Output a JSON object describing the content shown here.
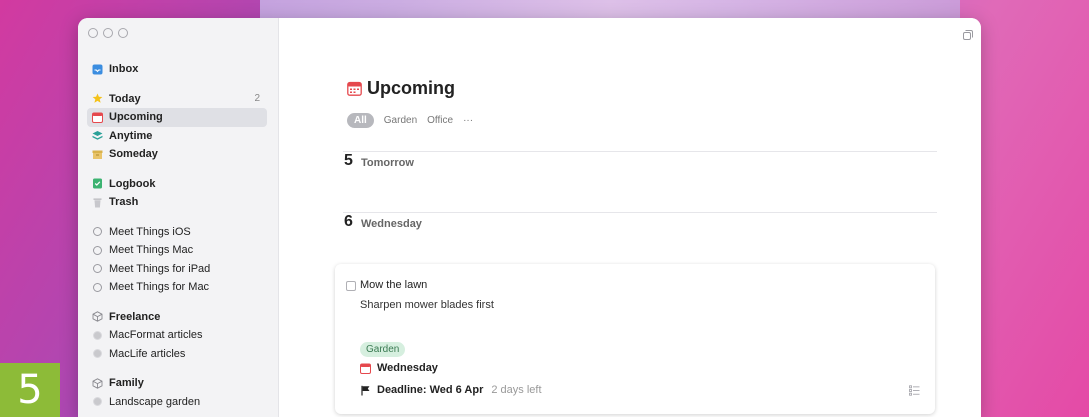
{
  "sidebar": {
    "inbox": "Inbox",
    "today": "Today",
    "today_count": "2",
    "upcoming": "Upcoming",
    "anytime": "Anytime",
    "someday": "Someday",
    "logbook": "Logbook",
    "trash": "Trash",
    "projects": [
      "Meet Things iOS",
      "Meet Things Mac",
      "Meet Things for iPad",
      "Meet Things for Mac"
    ],
    "areas": [
      {
        "name": "Freelance",
        "projects": [
          "MacFormat articles",
          "MacLife articles"
        ]
      },
      {
        "name": "Family",
        "projects": [
          "Landscape garden"
        ]
      }
    ]
  },
  "main": {
    "title": "Upcoming",
    "filters": {
      "all": "All",
      "tags": [
        "Garden",
        "Office"
      ],
      "more": "···"
    },
    "days": [
      {
        "num": "5",
        "name": "Tomorrow"
      },
      {
        "num": "6",
        "name": "Wednesday"
      }
    ],
    "task": {
      "title": "Mow the lawn",
      "notes": "Sharpen mower blades first",
      "tag": "Garden",
      "when": "Wednesday",
      "deadline": "Deadline: Wed 6 Apr",
      "days_left": "2 days left"
    }
  },
  "overlay": {
    "step": "5"
  },
  "colors": {
    "accent_today": "#f4c21a",
    "upcoming_red": "#e5484d",
    "anytime_teal": "#2aa198",
    "someday_yellow": "#e9c46a",
    "logbook_green": "#3cb371",
    "badge_green": "#8dbb38"
  }
}
